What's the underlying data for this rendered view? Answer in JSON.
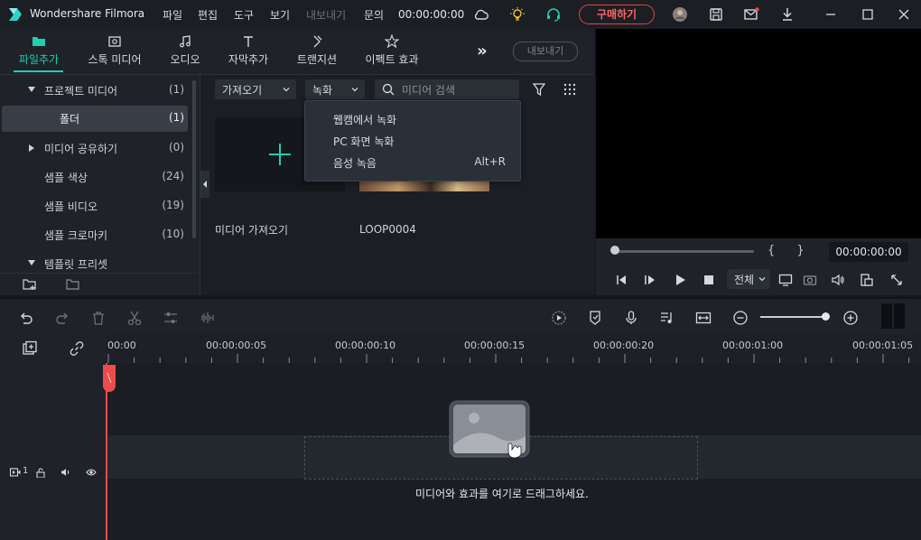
{
  "titlebar": {
    "app_title": "Wondershare Filmora",
    "menu": [
      "파일",
      "편집",
      "도구",
      "보기",
      "내보내기",
      "문의"
    ],
    "time": "00:00:00:00",
    "buy_label": "구매하기",
    "icons": [
      "cloud-icon",
      "bulb-icon",
      "headset-icon",
      "avatar",
      "save-icon",
      "mail-icon",
      "download-icon",
      "minimize-icon",
      "maximize-icon",
      "close-icon"
    ]
  },
  "media_tabs": {
    "items": [
      {
        "label": "파일추가",
        "icon": "folder-icon"
      },
      {
        "label": "스톡 미디어",
        "icon": "stock-media-icon"
      },
      {
        "label": "오디오",
        "icon": "music-note-icon"
      },
      {
        "label": "자막추가",
        "icon": "text-icon"
      },
      {
        "label": "트랜지션",
        "icon": "transition-icon"
      },
      {
        "label": "이펙트 효과",
        "icon": "effects-icon"
      }
    ],
    "more": "»",
    "export_label": "내보내기"
  },
  "tree": [
    {
      "label": "프로젝트 미디어",
      "count": "(1)",
      "arrow": "down"
    },
    {
      "label": "폴더",
      "count": "(1)",
      "selected": true
    },
    {
      "label": "미디어 공유하기",
      "count": "(0)",
      "arrow": "right"
    },
    {
      "label": "샘플 색상",
      "count": "(24)"
    },
    {
      "label": "샘플 비디오",
      "count": "(19)"
    },
    {
      "label": "샘플 크로마키",
      "count": "(10)"
    },
    {
      "label": "템플릿 프리셋",
      "count": "",
      "arrow": "down"
    }
  ],
  "media_toolbar": {
    "import_label": "가져오기",
    "record_label": "녹화",
    "search_placeholder": "미디어 검색"
  },
  "record_menu": {
    "items": [
      {
        "label": "웹캠에서 녹화",
        "shortcut": ""
      },
      {
        "label": "PC 화면 녹화",
        "shortcut": ""
      },
      {
        "label": "음성 녹음",
        "shortcut": "Alt+R"
      }
    ]
  },
  "media_items": {
    "import_label": "미디어 가져오기",
    "clip_label": "LOOP0004"
  },
  "preview": {
    "braces": "{ }",
    "time": "00:00:00:00",
    "quality": "전체"
  },
  "ruler": {
    "labels": [
      "00:00",
      "00:00:00:05",
      "00:00:00:10",
      "00:00:00:15",
      "00:00:00:20",
      "00:00:01:00",
      "00:00:01:05"
    ]
  },
  "tracks": {
    "drop_text": "미디어와 효과를 여기로 드래그하세요.",
    "track_number": "1"
  },
  "colors": {
    "accent": "#1fcfb0",
    "buy": "#e04545",
    "playhead": "#ee4b4b"
  }
}
